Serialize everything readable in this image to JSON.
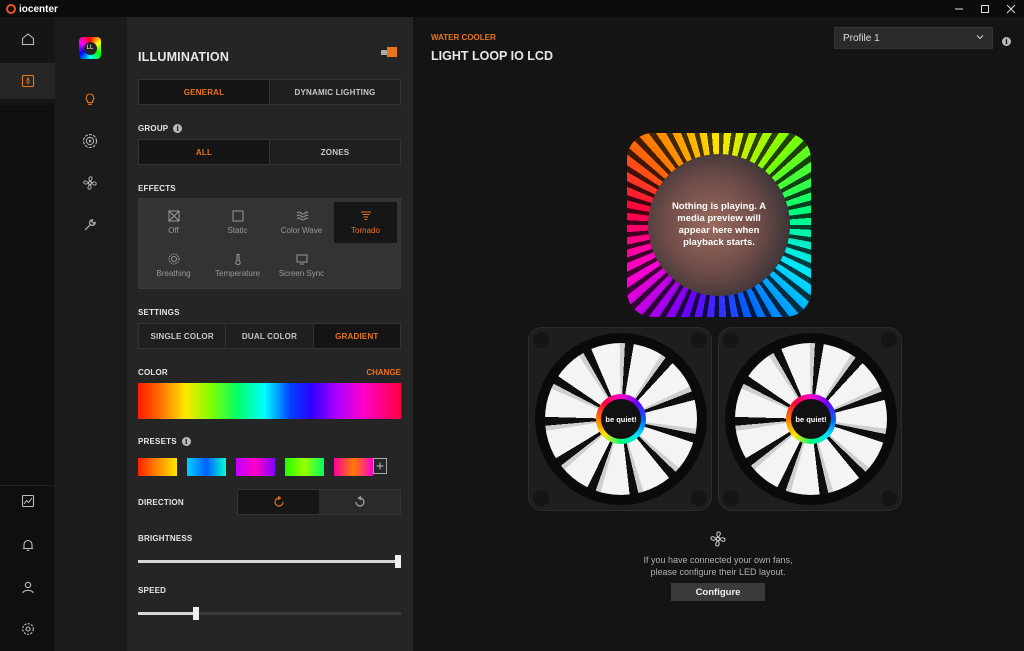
{
  "app": {
    "logo_text": "iocenter",
    "minimize": "—",
    "maximize": "☐",
    "close": "✕"
  },
  "nav1": {
    "items": [
      {
        "name": "home",
        "icon": "home-icon"
      },
      {
        "name": "device",
        "icon": "device-icon",
        "active": true
      },
      {
        "name": "monitoring",
        "icon": "chart-icon"
      },
      {
        "name": "notifications",
        "icon": "bell-icon"
      },
      {
        "name": "account",
        "icon": "user-icon"
      },
      {
        "name": "settings",
        "icon": "gear-icon"
      }
    ]
  },
  "nav2": {
    "device_thumb_text": "LL",
    "items": [
      {
        "name": "illumination",
        "icon": "lightbulb-icon",
        "active": true
      },
      {
        "name": "pump",
        "icon": "pump-icon"
      },
      {
        "name": "fans",
        "icon": "fan-icon"
      },
      {
        "name": "tools",
        "icon": "wrench-icon"
      }
    ]
  },
  "illumination": {
    "title": "ILLUMINATION",
    "tabs": [
      "GENERAL",
      "DYNAMIC LIGHTING"
    ],
    "tab_selected": "GENERAL",
    "group_label": "GROUP",
    "group_options": [
      "ALL",
      "ZONES"
    ],
    "group_selected": "ALL",
    "effects_label": "EFFECTS",
    "effects": [
      "Off",
      "Static",
      "Color Wave",
      "Tornado",
      "Breathing",
      "Temperature",
      "Screen Sync"
    ],
    "effect_selected": "Tornado",
    "settings_label": "SETTINGS",
    "settings_options": [
      "SINGLE COLOR",
      "DUAL COLOR",
      "GRADIENT"
    ],
    "settings_selected": "GRADIENT",
    "color_label": "COLOR",
    "change_label": "CHANGE",
    "presets_label": "PRESETS",
    "presets": [
      "linear-gradient(to right,#ff2000,#ff8a00,#ffe600)",
      "linear-gradient(to right,#00d0ff,#0060ff,#00ffd0)",
      "linear-gradient(to right,#c000ff,#ff00c8,#8000ff)",
      "linear-gradient(to right,#20ff00,#9aff00,#00ff60)",
      "linear-gradient(to right,#ff00a0,#ff7a00,#ff00d0)"
    ],
    "direction_label": "DIRECTION",
    "direction_selected": "clockwise",
    "brightness_label": "BRIGHTNESS",
    "brightness_value": 1.0,
    "speed_label": "SPEED",
    "speed_value": 0.22
  },
  "main": {
    "category": "WATER COOLER",
    "device_name": "LIGHT LOOP IO LCD",
    "profile": "Profile 1",
    "lcd_message": "Nothing is playing. A media preview will appear here when playback starts.",
    "fan_brand": "be quiet!",
    "hint_line1": "If you have connected your own fans,",
    "hint_line2": "please configure their LED layout.",
    "configure_label": "Configure"
  },
  "colors": {
    "accent": "#e8741c",
    "panel": "#252525",
    "background": "#141414"
  }
}
